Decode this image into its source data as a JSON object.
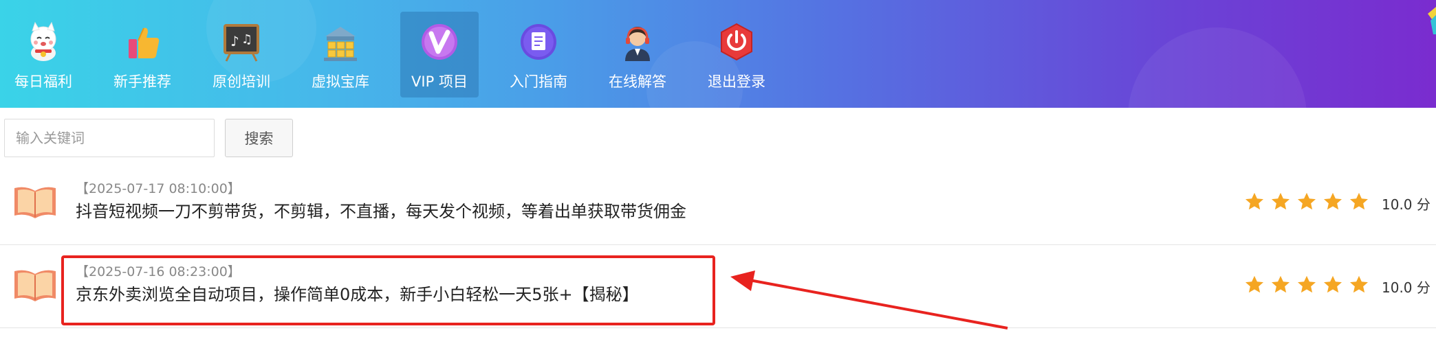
{
  "nav": {
    "items": [
      {
        "label": "每日福利",
        "icon": "lucky-cat-icon"
      },
      {
        "label": "新手推荐",
        "icon": "thumbs-up-icon"
      },
      {
        "label": "原创培训",
        "icon": "music-chalkboard-icon"
      },
      {
        "label": "虚拟宝库",
        "icon": "treasure-boxes-icon"
      },
      {
        "label": "VIP 项目",
        "icon": "vip-badge-icon",
        "active": true
      },
      {
        "label": "入门指南",
        "icon": "document-icon"
      },
      {
        "label": "在线解答",
        "icon": "customer-service-icon"
      },
      {
        "label": "退出登录",
        "icon": "power-icon"
      }
    ]
  },
  "search": {
    "placeholder": "输入关键词",
    "value": "",
    "button_label": "搜索"
  },
  "list": {
    "items": [
      {
        "date": "【2025-07-17 08:10:00】",
        "title": "抖音短视频一刀不剪带货，不剪辑，不直播，每天发个视频，等着出单获取带货佣金",
        "rating_stars": 5,
        "score": "10.0 分"
      },
      {
        "date": "【2025-07-16 08:23:00】",
        "title": "京东外卖浏览全自动项目，操作简单0成本，新手小白轻松一天5张+【揭秘】",
        "rating_stars": 5,
        "score": "10.0 分",
        "highlighted": true
      }
    ]
  },
  "colors": {
    "nav_gradient_start": "#3ad3e8",
    "nav_gradient_end": "#7a2ccf",
    "star": "#f5a623",
    "annotation": "#e8231f",
    "book_icon": "#f08a66"
  }
}
